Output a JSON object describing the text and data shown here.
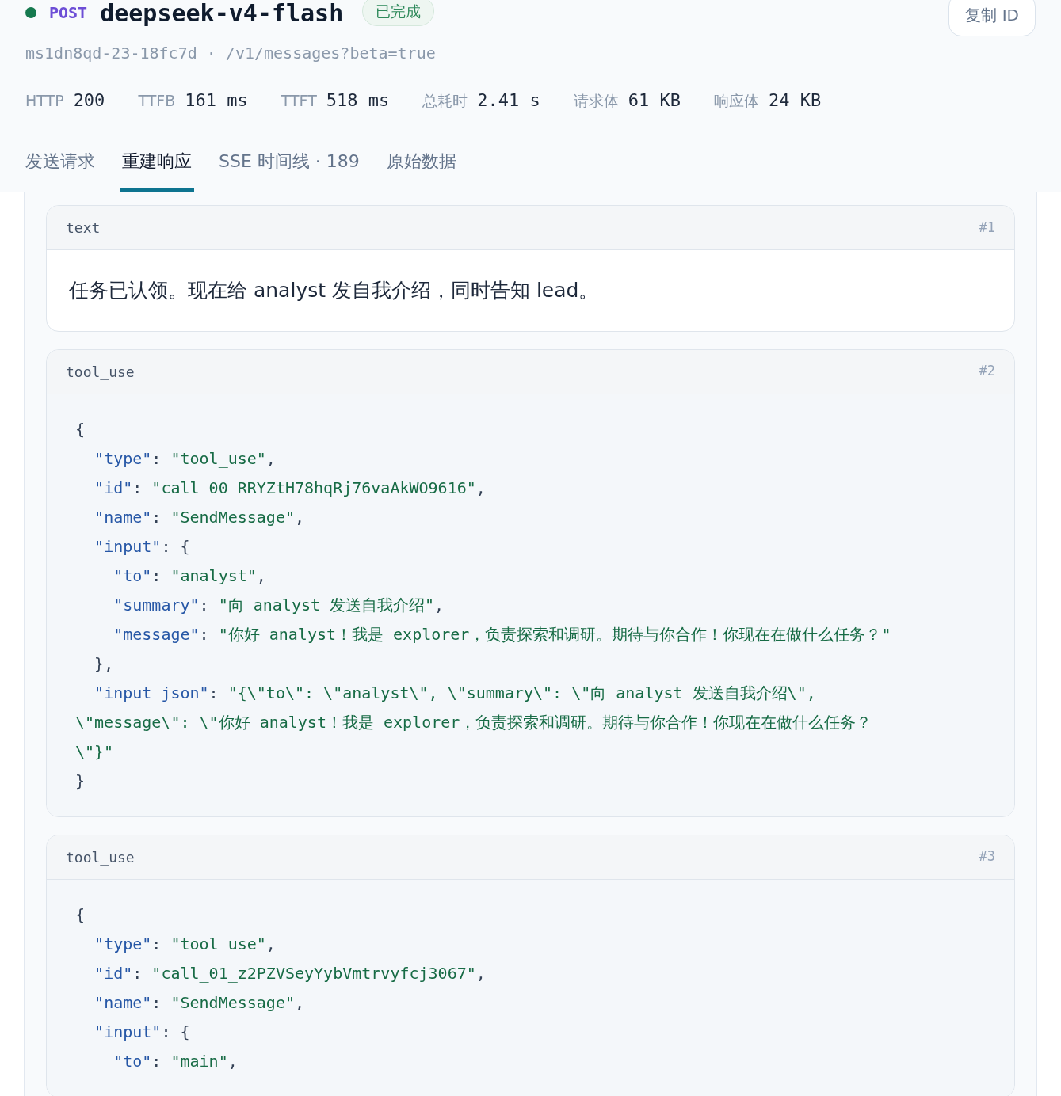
{
  "request": {
    "method": "POST",
    "model": "deepseek-v4-flash",
    "status": "已完成",
    "copy_button": "复制 ID",
    "subtitle": "ms1dn8qd-23-18fc7d · /v1/messages?beta=true"
  },
  "metrics": [
    {
      "label": "HTTP",
      "value": "200"
    },
    {
      "label": "TTFB",
      "value": "161 ms"
    },
    {
      "label": "TTFT",
      "value": "518 ms"
    },
    {
      "label": "总耗时",
      "value": "2.41 s"
    },
    {
      "label": "请求体",
      "value": "61 KB"
    },
    {
      "label": "响应体",
      "value": "24 KB"
    }
  ],
  "tabs": [
    {
      "label": "发送请求",
      "selected": false
    },
    {
      "label": "重建响应",
      "selected": true
    },
    {
      "label": "SSE 时间线 · 189",
      "selected": false
    },
    {
      "label": "原始数据",
      "selected": false
    }
  ],
  "blocks": [
    {
      "kind": "text",
      "type_label": "text",
      "index": "#1",
      "text": "任务已认领。现在给 analyst 发自我介绍，同时告知 lead。"
    },
    {
      "kind": "code",
      "type_label": "tool_use",
      "index": "#2",
      "lines": [
        [
          {
            "kind": "punct",
            "text": "{"
          }
        ],
        [
          {
            "kind": "key",
            "text": "  \"type\""
          },
          {
            "kind": "punct",
            "text": ": "
          },
          {
            "kind": "string",
            "text": "\"tool_use\""
          },
          {
            "kind": "punct",
            "text": ","
          }
        ],
        [
          {
            "kind": "key",
            "text": "  \"id\""
          },
          {
            "kind": "punct",
            "text": ": "
          },
          {
            "kind": "string",
            "text": "\"call_00_RRYZtH78hqRj76vaAkWO9616\""
          },
          {
            "kind": "punct",
            "text": ","
          }
        ],
        [
          {
            "kind": "key",
            "text": "  \"name\""
          },
          {
            "kind": "punct",
            "text": ": "
          },
          {
            "kind": "string",
            "text": "\"SendMessage\""
          },
          {
            "kind": "punct",
            "text": ","
          }
        ],
        [
          {
            "kind": "key",
            "text": "  \"input\""
          },
          {
            "kind": "punct",
            "text": ": {"
          }
        ],
        [
          {
            "kind": "key",
            "text": "    \"to\""
          },
          {
            "kind": "punct",
            "text": ": "
          },
          {
            "kind": "string",
            "text": "\"analyst\""
          },
          {
            "kind": "punct",
            "text": ","
          }
        ],
        [
          {
            "kind": "key",
            "text": "    \"summary\""
          },
          {
            "kind": "punct",
            "text": ": "
          },
          {
            "kind": "string",
            "text": "\"向 analyst 发送自我介绍\""
          },
          {
            "kind": "punct",
            "text": ","
          }
        ],
        [
          {
            "kind": "key",
            "text": "    \"message\""
          },
          {
            "kind": "punct",
            "text": ": "
          },
          {
            "kind": "string",
            "text": "\"你好 analyst！我是 explorer，负责探索和调研。期待与你合作！你现在在做什么任务？\""
          }
        ],
        [
          {
            "kind": "punct",
            "text": "  },"
          }
        ],
        [
          {
            "kind": "key",
            "text": "  \"input_json\""
          },
          {
            "kind": "punct",
            "text": ": "
          },
          {
            "kind": "string",
            "text": "\"{\\\"to\\\": \\\"analyst\\\", \\\"summary\\\": \\\"向 analyst 发送自我介绍\\\","
          }
        ],
        [
          {
            "kind": "string",
            "text": "\\\"message\\\": \\\"你好 analyst！我是 explorer，负责探索和调研。期待与你合作！你现在在做什么任务？"
          }
        ],
        [
          {
            "kind": "string",
            "text": "\\\"}\""
          }
        ],
        [
          {
            "kind": "punct",
            "text": "}"
          }
        ]
      ]
    },
    {
      "kind": "code",
      "type_label": "tool_use",
      "index": "#3",
      "lines": [
        [
          {
            "kind": "punct",
            "text": "{"
          }
        ],
        [
          {
            "kind": "key",
            "text": "  \"type\""
          },
          {
            "kind": "punct",
            "text": ": "
          },
          {
            "kind": "string",
            "text": "\"tool_use\""
          },
          {
            "kind": "punct",
            "text": ","
          }
        ],
        [
          {
            "kind": "key",
            "text": "  \"id\""
          },
          {
            "kind": "punct",
            "text": ": "
          },
          {
            "kind": "string",
            "text": "\"call_01_z2PZVSeyYybVmtrvyfcj3067\""
          },
          {
            "kind": "punct",
            "text": ","
          }
        ],
        [
          {
            "kind": "key",
            "text": "  \"name\""
          },
          {
            "kind": "punct",
            "text": ": "
          },
          {
            "kind": "string",
            "text": "\"SendMessage\""
          },
          {
            "kind": "punct",
            "text": ","
          }
        ],
        [
          {
            "kind": "key",
            "text": "  \"input\""
          },
          {
            "kind": "punct",
            "text": ": {"
          }
        ],
        [
          {
            "kind": "key",
            "text": "    \"to\""
          },
          {
            "kind": "punct",
            "text": ": "
          },
          {
            "kind": "string",
            "text": "\"main\""
          },
          {
            "kind": "punct",
            "text": ","
          }
        ]
      ]
    }
  ]
}
